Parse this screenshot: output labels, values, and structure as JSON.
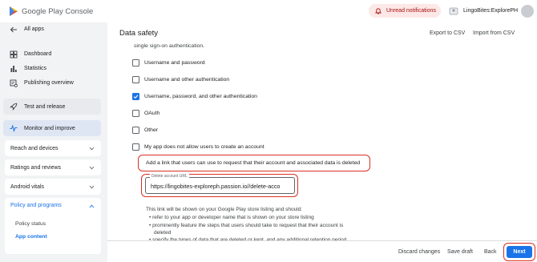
{
  "app": {
    "brand": "Google Play Console"
  },
  "topbar": {
    "notifications_label": "Unread notifications",
    "account_name": "LingoBites:ExplorePH"
  },
  "sidebar": {
    "all_apps": "All apps",
    "items": [
      {
        "label": "Dashboard",
        "icon": "dashboard-icon"
      },
      {
        "label": "Statistics",
        "icon": "bar-chart-icon"
      },
      {
        "label": "Publishing overview",
        "icon": "publish-icon"
      }
    ],
    "test_release": "Test and release",
    "monitor": "Monitor and improve",
    "sections": [
      "Reach and devices",
      "Ratings and reviews",
      "Android vitals",
      "Policy and programs"
    ],
    "sub_items": [
      "Policy status",
      "App content"
    ]
  },
  "main": {
    "title": "Data safety",
    "export_label": "Export to CSV",
    "import_label": "Import from CSV",
    "intro_text": "single sign-on authentication.",
    "options": [
      {
        "label": "Username and password",
        "checked": false
      },
      {
        "label": "Username and other authentication",
        "checked": false
      },
      {
        "label": "Username, password, and other authentication",
        "checked": true
      },
      {
        "label": "OAuth",
        "checked": false
      },
      {
        "label": "Other",
        "checked": false
      },
      {
        "label": "My app does not allow users to create an account",
        "checked": false
      }
    ],
    "delete_prompt": "Add a link that users can use to request that their account and associated data is deleted",
    "delete_field_label": "Delete account URL",
    "delete_field_value": "https://lingobites-exploreph.passion.io//delete-acco",
    "note_intro": "This link will be shown on your Google Play store listing and should:",
    "note_bullets": [
      "refer to your app or developer name that is shown on your store listing",
      "prominently feature the steps that users should take to request that their account is",
      "deleted",
      "specify the types of data that are deleted or kept, and any additional retention period"
    ]
  },
  "footer": {
    "discard": "Discard changes",
    "save_draft": "Save draft",
    "back": "Back",
    "next": "Next"
  },
  "colors": {
    "accent": "#1a73e8",
    "highlight": "#d93025",
    "notif_bg": "#fce8e6"
  }
}
